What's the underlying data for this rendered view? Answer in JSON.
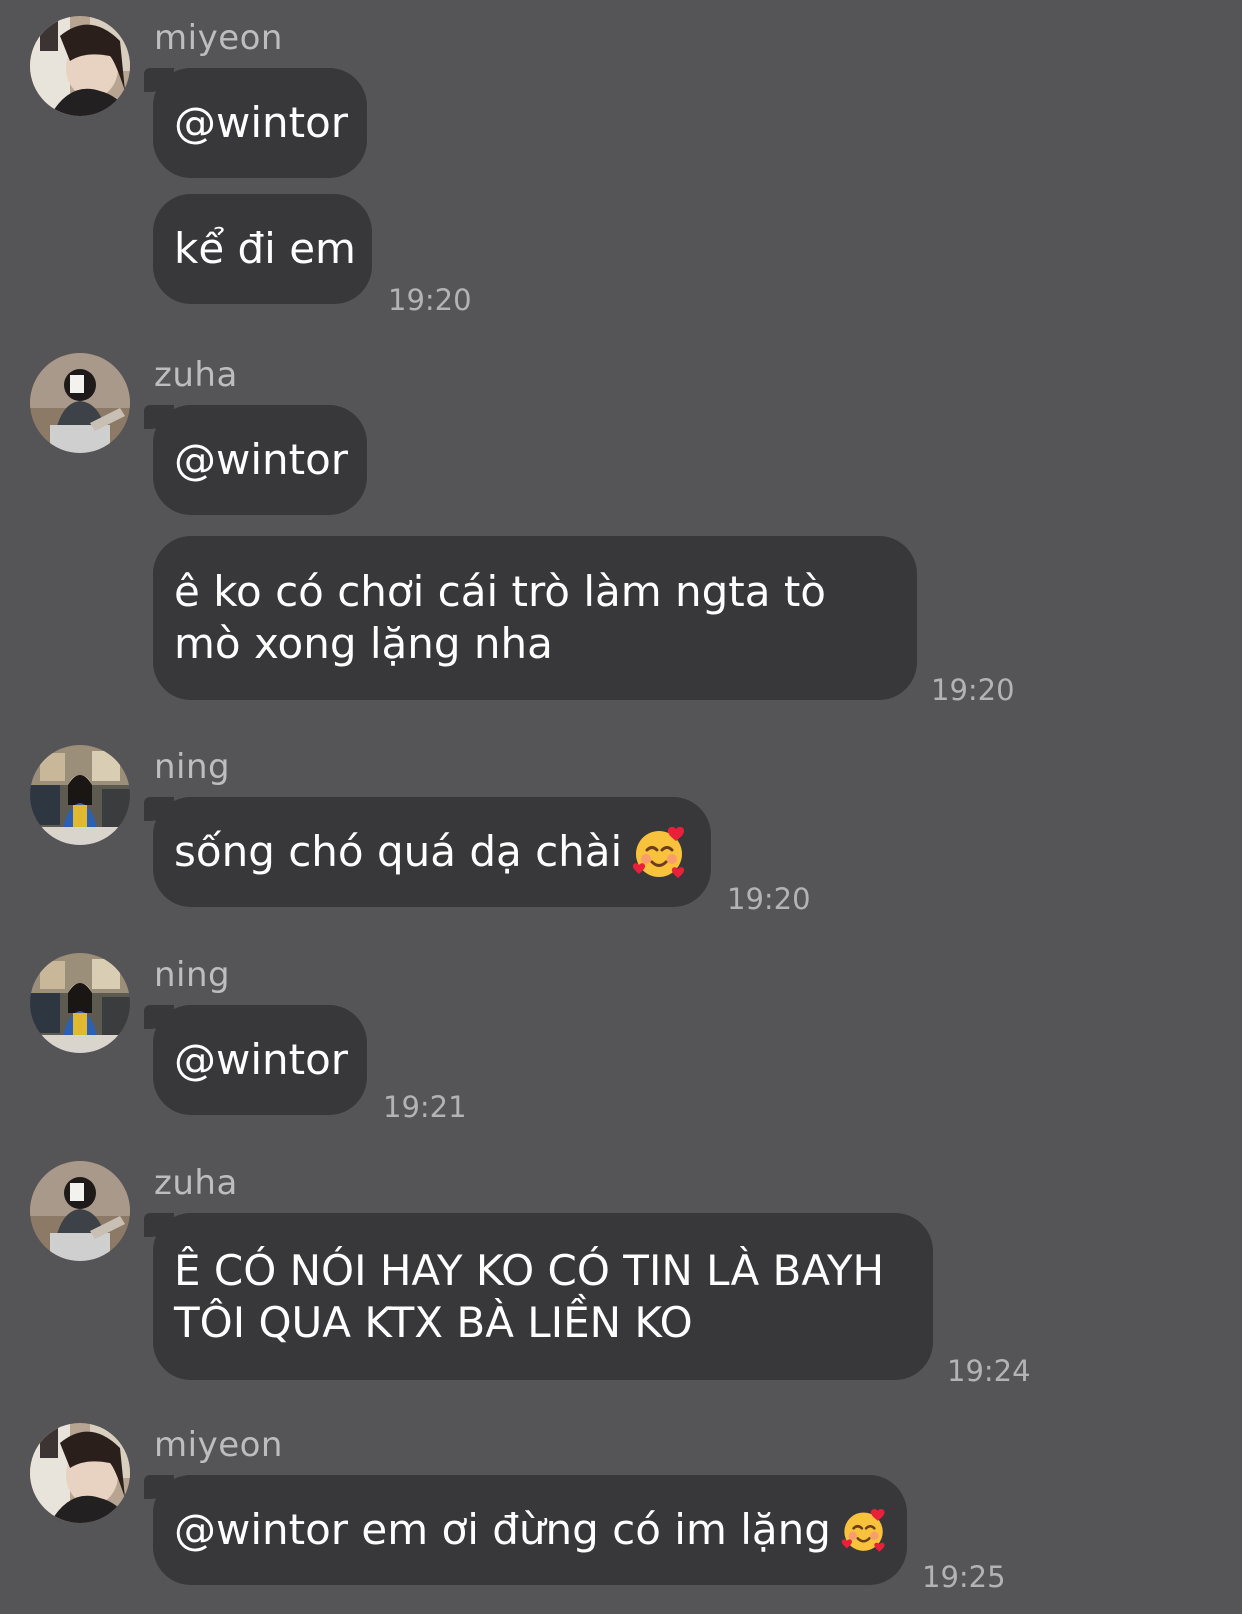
{
  "messages": [
    {
      "sender": "miyeon",
      "avatar": "avatar-miyeon",
      "bubbles": [
        "@wintor",
        "kể đi em"
      ],
      "time": "19:20"
    },
    {
      "sender": "zuha",
      "avatar": "avatar-zuha",
      "bubbles": [
        "@wintor",
        "ê ko có chơi cái trò làm ngta tò mò xong lặng nha"
      ],
      "time": "19:20"
    },
    {
      "sender": "ning",
      "avatar": "avatar-ning",
      "bubbles": [
        "sống chó quá dạ chài"
      ],
      "emoji": "smiling-face-with-hearts",
      "time": "19:20"
    },
    {
      "sender": "ning",
      "avatar": "avatar-ning",
      "bubbles": [
        "@wintor"
      ],
      "time": "19:21"
    },
    {
      "sender": "zuha",
      "avatar": "avatar-zuha",
      "bubbles": [
        "Ê CÓ NÓI HAY KO CÓ TIN LÀ BAYH TÔI QUA KTX BÀ LIỀN KO"
      ],
      "time": "19:24"
    },
    {
      "sender": "miyeon",
      "avatar": "avatar-miyeon",
      "bubbles": [
        "@wintor em ơi đừng có im lặng"
      ],
      "emoji": "smiling-face-with-hearts",
      "time": "19:25"
    }
  ],
  "colors": {
    "background": "#555456",
    "bubble": "#383739",
    "text": "#ffffff",
    "sender": "#bdbcbf",
    "time": "#b3b2b5"
  }
}
